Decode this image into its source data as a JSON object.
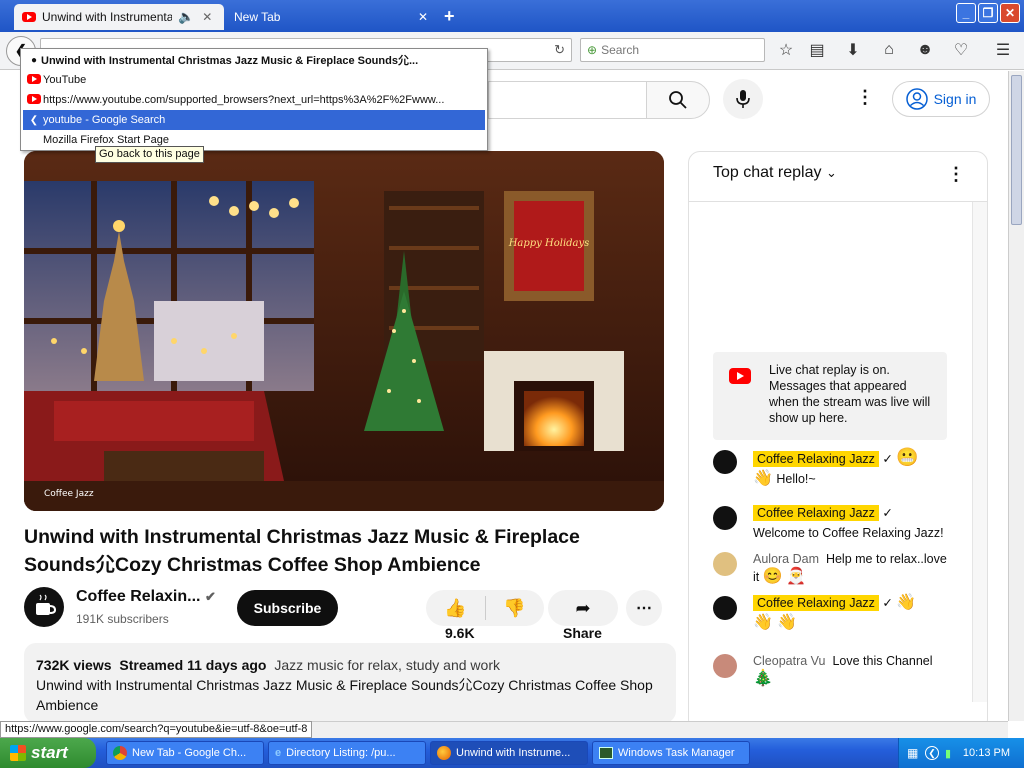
{
  "browser": {
    "tabs": [
      {
        "title": "Unwind with Instrumental...",
        "active": true
      },
      {
        "title": "New Tab",
        "active": false
      }
    ],
    "new_tab": "+",
    "search_placeholder": "Search",
    "status_url": "https://www.google.com/search?q=youtube&ie=utf-8&oe=utf-8",
    "window_buttons": {
      "minimize": "_",
      "restore": "❐",
      "close": "✕"
    }
  },
  "history_dropdown": {
    "items": [
      {
        "label": "Unwind with Instrumental Christmas Jazz Music & Fireplace Sounds⺏...",
        "marker": "●",
        "bold": true
      },
      {
        "label": "YouTube",
        "marker": "yt"
      },
      {
        "label": "https://www.youtube.com/supported_browsers?next_url=https%3A%2F%2Fwww...",
        "marker": "yt"
      },
      {
        "label": "youtube - Google Search",
        "marker": "back",
        "selected": true
      },
      {
        "label": "Mozilla Firefox Start Page",
        "marker": ""
      }
    ],
    "tooltip": "Go back to this page"
  },
  "youtube": {
    "sign_in": "Sign in",
    "video_title": "Unwind with Instrumental Christmas Jazz Music & Fireplace Sounds⺏Cozy Christmas Coffee Shop Ambience",
    "channel": {
      "name": "Coffee Relaxin...",
      "subscribers": "191K subscribers"
    },
    "subscribe": "Subscribe",
    "likes": "9.6K",
    "share": "Share",
    "description": {
      "views": "732K views",
      "streamed": "Streamed 11 days ago",
      "tags": "Jazz music for relax, study and work",
      "text": "Unwind with Instrumental Christmas Jazz Music & Fireplace Sounds⺏Cozy Christmas Coffee Shop Ambience"
    },
    "video_thumb": {
      "sign_text": "Happy Holidays",
      "logo_text": "Coffee Jazz"
    },
    "chat": {
      "header": "Top chat replay",
      "notice": "Live chat replay is on. Messages that appeared when the stream was live will show up here.",
      "messages": [
        {
          "author": "Coffee Relaxing Jazz",
          "owner": true,
          "text": "Hello!~"
        },
        {
          "author": "Coffee Relaxing Jazz",
          "owner": true,
          "text": "Welcome to Coffee Relaxing Jazz!"
        },
        {
          "author": "Aulora Dam",
          "owner": false,
          "text": "Help me to relax..love it"
        },
        {
          "author": "Coffee Relaxing Jazz",
          "owner": true,
          "text": ""
        },
        {
          "author": "Cleopatra Vu",
          "owner": false,
          "text": "Love this Channel"
        }
      ]
    }
  },
  "taskbar": {
    "start": "start",
    "tasks": [
      {
        "label": "New Tab - Google Ch...",
        "active": false
      },
      {
        "label": "Directory Listing: /pu...",
        "active": false
      },
      {
        "label": "Unwind with Instrume...",
        "active": true
      },
      {
        "label": "Windows Task Manager",
        "active": false
      }
    ],
    "clock": "10:13 PM"
  },
  "colors": {
    "accent_blue": "#3367d6",
    "yt_red": "#ff0000",
    "owner_highlight": "#ffd600",
    "signin_blue": "#065fd4"
  }
}
